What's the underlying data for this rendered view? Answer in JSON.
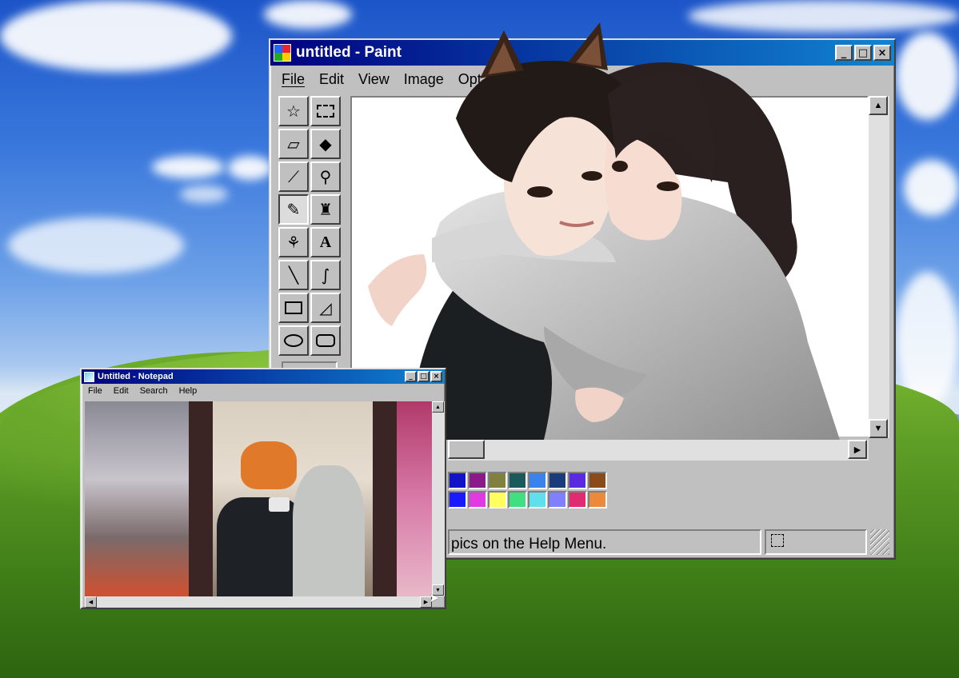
{
  "paint": {
    "title": "untitled - Paint",
    "menu": [
      "File",
      "Edit",
      "View",
      "Image",
      "Opt"
    ],
    "status_text": "pics on the Help Menu.",
    "palette_top": [
      "#1212c8",
      "#8a1a8a",
      "#808040",
      "#1a5a5a",
      "#3c82ec",
      "#1a3c7a",
      "#5a2ae0",
      "#8a4a1a"
    ],
    "palette_bottom": [
      "#1a1aff",
      "#e23ae2",
      "#ffff60",
      "#40e080",
      "#60e0ec",
      "#8080ff",
      "#e02a72",
      "#ec8a3c"
    ]
  },
  "notepad": {
    "title": "Untitled - Notepad",
    "menu": [
      "File",
      "Edit",
      "Search",
      "Help"
    ]
  },
  "titlebar_buttons": {
    "minimize": "_",
    "maximize": "□",
    "close": "×"
  },
  "scroll_arrows": {
    "up": "▲",
    "down": "▼",
    "left": "◀",
    "right": "▶"
  },
  "colors": {
    "titlebar": "#000080",
    "face": "#c0c0c0"
  }
}
